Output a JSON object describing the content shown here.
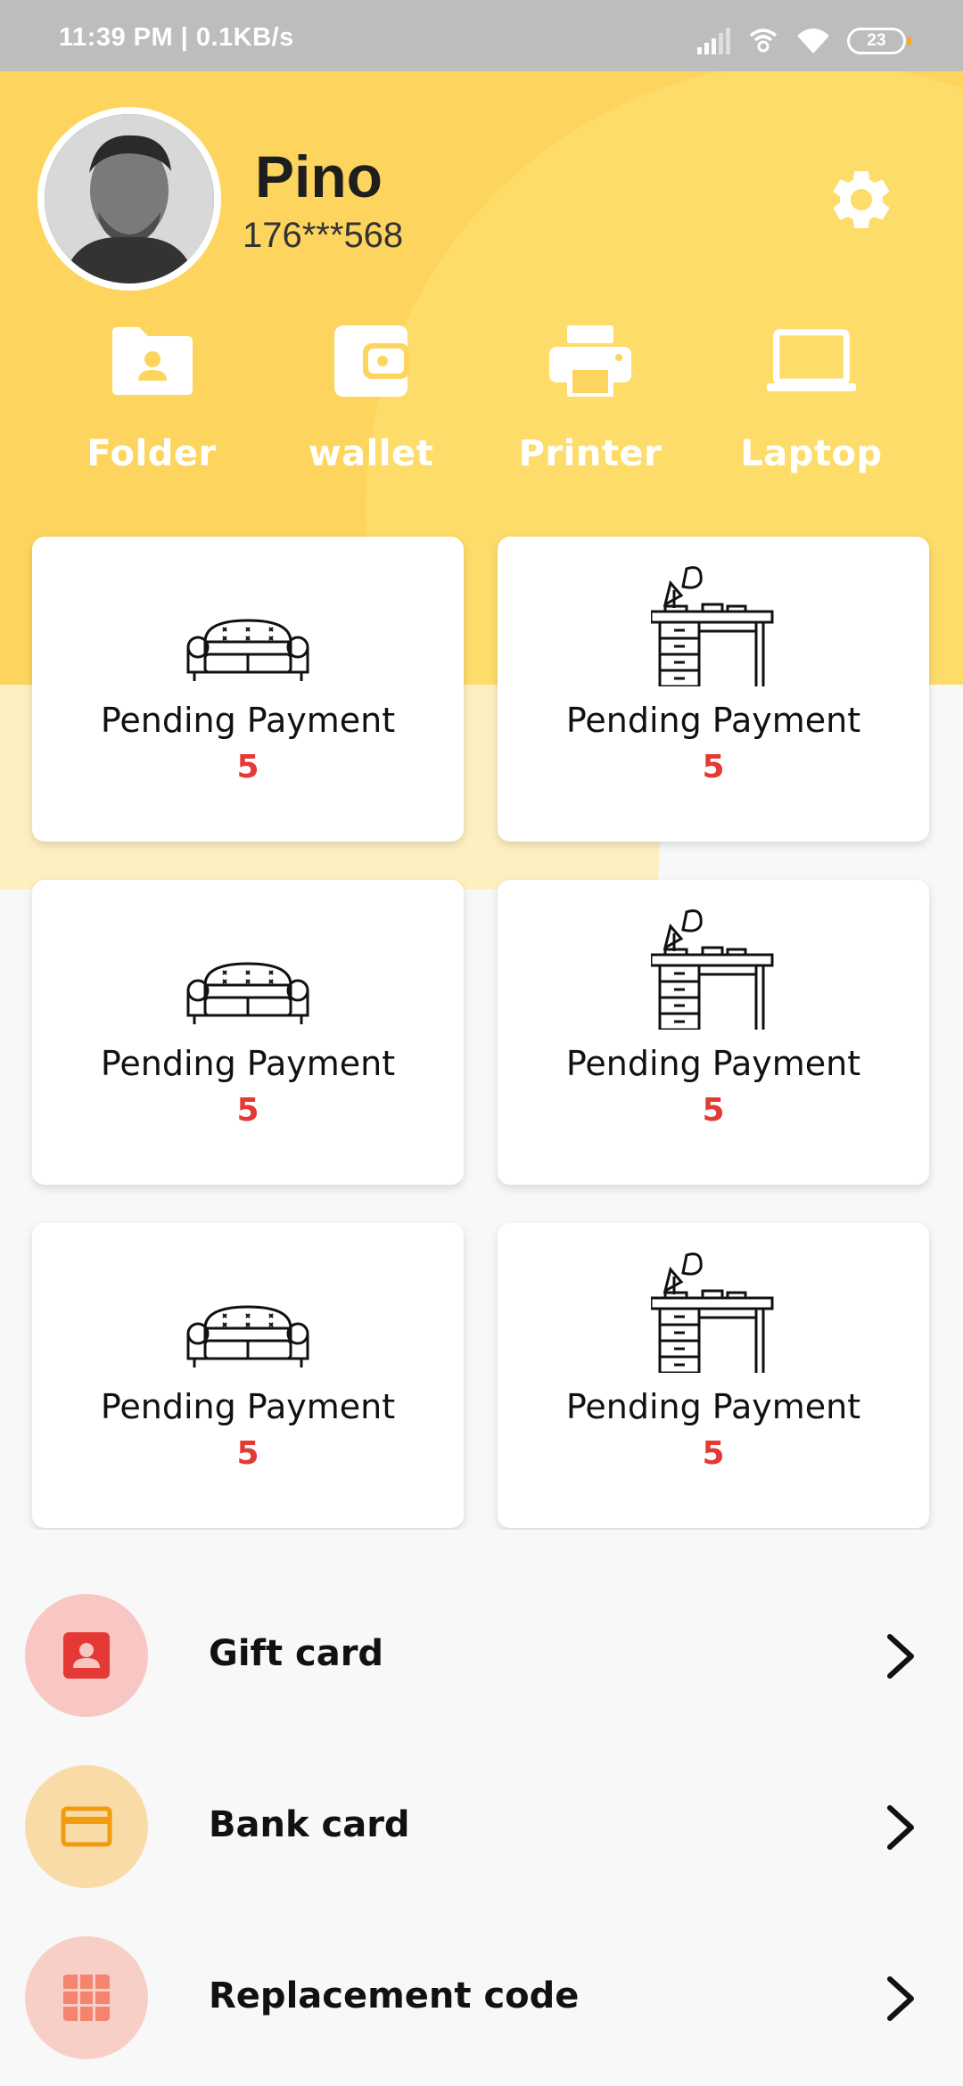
{
  "status_bar": {
    "time": "11:39 PM | 0.1KB/s",
    "battery": "23"
  },
  "profile": {
    "name": "Pino",
    "phone": "176***568",
    "avatar_icon": "person-photo"
  },
  "quick_actions": [
    {
      "label": "Folder",
      "icon": "folder-icon"
    },
    {
      "label": "wallet",
      "icon": "wallet-icon"
    },
    {
      "label": "Printer",
      "icon": "printer-icon"
    },
    {
      "label": "Laptop",
      "icon": "laptop-icon"
    }
  ],
  "cards": [
    {
      "label": "Pending Payment",
      "count": "5",
      "icon": "sofa-icon"
    },
    {
      "label": "Pending Payment",
      "count": "5",
      "icon": "desk-lamp-icon"
    },
    {
      "label": "Pending Payment",
      "count": "5",
      "icon": "sofa-icon"
    },
    {
      "label": "Pending Payment",
      "count": "5",
      "icon": "desk-lamp-icon"
    },
    {
      "label": "Pending Payment",
      "count": "5",
      "icon": "sofa-icon"
    },
    {
      "label": "Pending Payment",
      "count": "5",
      "icon": "desk-lamp-icon"
    }
  ],
  "menu": [
    {
      "label": "Gift card",
      "icon": "contact-card-icon",
      "icon_color": "#e53935",
      "bg_color": "#f8c7c4"
    },
    {
      "label": "Bank card",
      "icon": "credit-card-icon",
      "icon_color": "#f29b0f",
      "bg_color": "#f8dba7"
    },
    {
      "label": "Replacement code",
      "icon": "grid-icon",
      "icon_color": "#f4846d",
      "bg_color": "#f8cfc6"
    }
  ],
  "colors": {
    "header": "#fdd55e",
    "count": "#e53935"
  }
}
